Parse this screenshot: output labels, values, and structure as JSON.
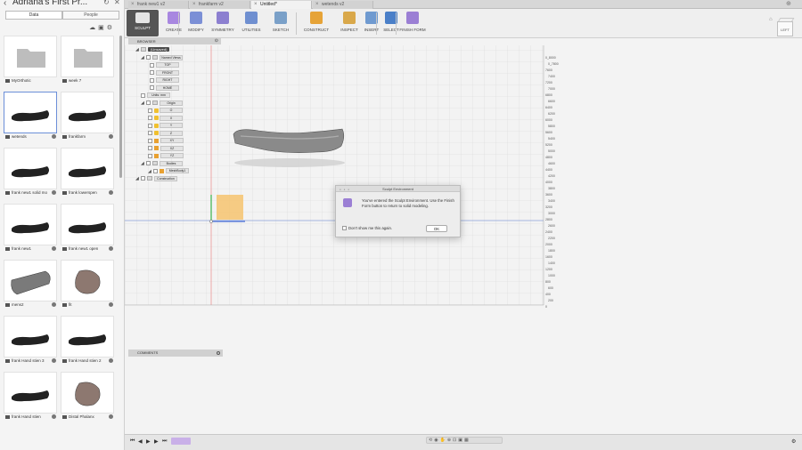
{
  "left_panel": {
    "project_title": "Adriana's First Pr...",
    "tabs": [
      {
        "label": "Data"
      },
      {
        "label": "People"
      }
    ],
    "items": [
      {
        "name": "MyOrthotic",
        "type": "folder"
      },
      {
        "name": "week 7",
        "type": "folder"
      },
      {
        "name": "wetends",
        "type": "arm"
      },
      {
        "name": "frankfarm",
        "type": "arm"
      },
      {
        "name": "frank new1 solid mo",
        "type": "arm"
      },
      {
        "name": "frank lowerspen",
        "type": "arm"
      },
      {
        "name": "frank new1",
        "type": "arm"
      },
      {
        "name": "frank new1 open",
        "type": "arm"
      },
      {
        "name": "mens2",
        "type": "cyl"
      },
      {
        "name": "fit",
        "type": "obj"
      },
      {
        "name": "frank Hand stien 3",
        "type": "arm"
      },
      {
        "name": "frank Hand stien 2",
        "type": "arm"
      },
      {
        "name": "frank Hand stien",
        "type": "arm"
      },
      {
        "name": "Distal Phalanx",
        "type": "obj"
      }
    ]
  },
  "tabs": [
    {
      "label": "frank new1 v2"
    },
    {
      "label": "frankfarm v2"
    },
    {
      "label": "Untitled*"
    },
    {
      "label": "wetends v2"
    }
  ],
  "toolbar": {
    "workspace": "SCULPT",
    "tools": [
      {
        "label": "CREATE",
        "color": "#a887e0"
      },
      {
        "label": "MODIFY",
        "color": "#7b8fd6"
      },
      {
        "label": "SYMMETRY",
        "color": "#8c7fd0"
      },
      {
        "label": "UTILITIES",
        "color": "#6f8fd0"
      },
      {
        "label": "SKETCH",
        "color": "#7aa0c8"
      },
      {
        "label": "CONSTRUCT",
        "color": "#e6a337"
      },
      {
        "label": "INSPECT",
        "color": "#d9a84a"
      },
      {
        "label": "INSERT",
        "color": "#6f9ad0"
      },
      {
        "label": "SELECT",
        "color": "#4a7fc8"
      },
      {
        "label": "FINISH FORM",
        "color": "#9b7fd4"
      }
    ]
  },
  "browser": {
    "header": "BROWSER",
    "root": "(Unsaved)",
    "nodes": [
      {
        "label": "Named Views"
      },
      {
        "label": "TOP"
      },
      {
        "label": "FRONT"
      },
      {
        "label": "RIGHT"
      },
      {
        "label": "HOME"
      },
      {
        "label": "Units: mm"
      },
      {
        "label": "Origin"
      },
      {
        "label": "O"
      },
      {
        "label": "X"
      },
      {
        "label": "Y"
      },
      {
        "label": "Z"
      },
      {
        "label": "XY"
      },
      {
        "label": "XZ"
      },
      {
        "label": "YZ"
      },
      {
        "label": "Bodies"
      },
      {
        "label": "MeshBody1"
      },
      {
        "label": "Construction"
      }
    ]
  },
  "comments": {
    "label": "COMMENTS"
  },
  "viewcube": {
    "face": "LEFT"
  },
  "dialog": {
    "title": "Sculpt Environment",
    "message": "You've entered the Sculpt Environment. Use the Finish Form button to return to solid modeling.",
    "checkbox": "Don't show me this again.",
    "ok": "OK"
  },
  "ruler_labels": [
    "0_8000",
    "0_7800",
    "7600",
    "7400",
    "7200",
    "7000",
    "6800",
    "6600",
    "6400",
    "6200",
    "6000",
    "5800",
    "5600",
    "5400",
    "5200",
    "5000",
    "4800",
    "4600",
    "4400",
    "4200",
    "4000",
    "3800",
    "3600",
    "3400",
    "3200",
    "3000",
    "2800",
    "2600",
    "2400",
    "2200",
    "2000",
    "1800",
    "1600",
    "1400",
    "1200",
    "1000",
    "800",
    "600",
    "400",
    "200",
    "0"
  ],
  "colors": {
    "accent": "#4a7fc8",
    "sculpt": "#9b7fd4",
    "face_orange": "#f6b13a"
  }
}
